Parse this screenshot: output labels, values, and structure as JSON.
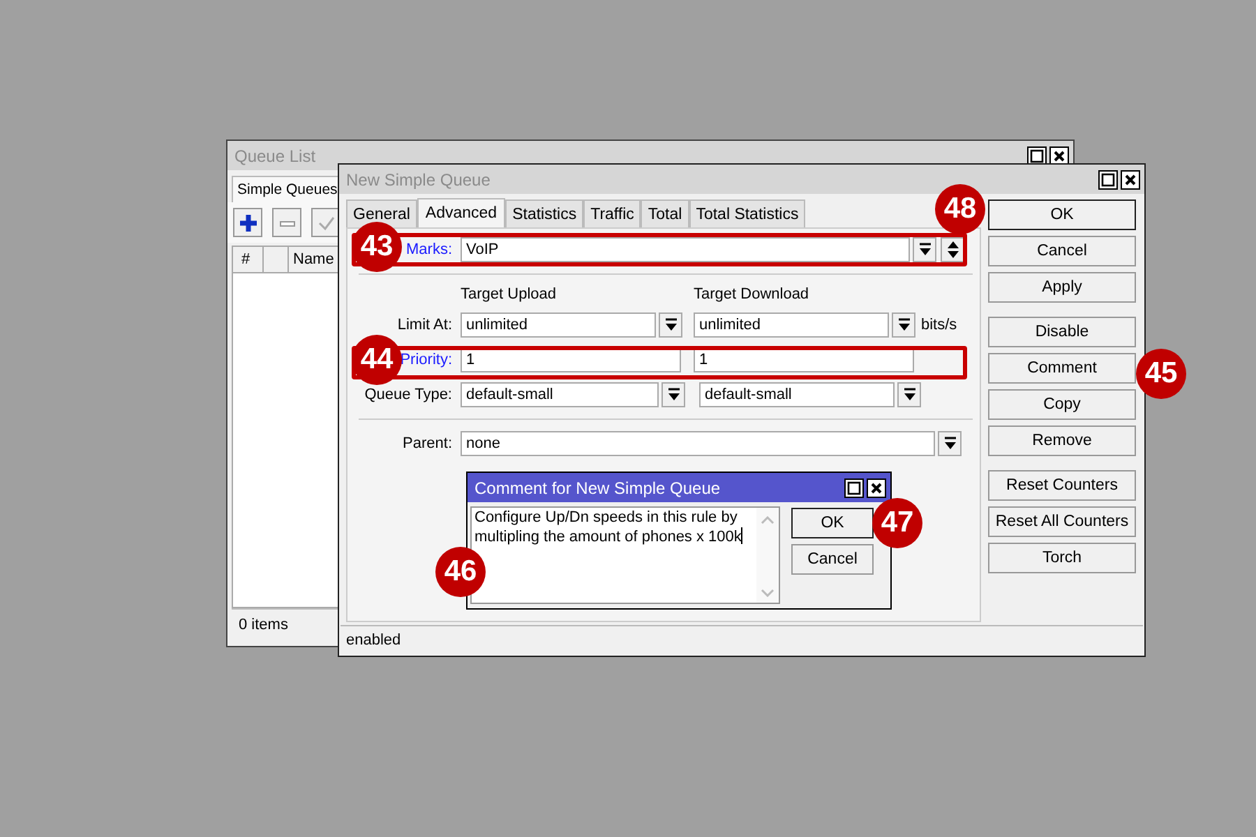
{
  "queue_list": {
    "title": "Queue List",
    "tabs": [
      {
        "label": "Simple Queues",
        "selected": true
      }
    ],
    "columns": [
      "#",
      "Name"
    ],
    "status": "0 items"
  },
  "dialog": {
    "title": "New Simple Queue",
    "tabs": [
      {
        "label": "General",
        "selected": false
      },
      {
        "label": "Advanced",
        "selected": true
      },
      {
        "label": "Statistics",
        "selected": false
      },
      {
        "label": "Traffic",
        "selected": false
      },
      {
        "label": "Total",
        "selected": false
      },
      {
        "label": "Total Statistics",
        "selected": false
      }
    ],
    "marks": {
      "label": "Marks:",
      "value": "VoIP"
    },
    "column_headers": [
      "Target Upload",
      "Target Download"
    ],
    "limit_at": {
      "label": "Limit At:",
      "upload": "unlimited",
      "download": "unlimited",
      "unit": "bits/s"
    },
    "priority": {
      "label": "Priority:",
      "upload": "1",
      "download": "1"
    },
    "queue_type": {
      "label": "Queue Type:",
      "upload": "default-small",
      "download": "default-small"
    },
    "parent": {
      "label": "Parent:",
      "value": "none"
    },
    "button_groups": [
      [
        {
          "label": "OK",
          "default": true
        },
        {
          "label": "Cancel",
          "default": false
        },
        {
          "label": "Apply",
          "default": false
        }
      ],
      [
        {
          "label": "Disable",
          "default": false
        },
        {
          "label": "Comment",
          "default": false
        },
        {
          "label": "Copy",
          "default": false
        },
        {
          "label": "Remove",
          "default": false
        }
      ],
      [
        {
          "label": "Reset Counters",
          "default": false
        },
        {
          "label": "Reset All Counters",
          "default": false
        },
        {
          "label": "Torch",
          "default": false
        }
      ]
    ],
    "status": "enabled"
  },
  "comment_dialog": {
    "title": "Comment for New Simple Queue",
    "text": "Configure Up/Dn speeds in this rule by multipling the amount of phones x 100k",
    "buttons": [
      {
        "label": "OK",
        "default": true
      },
      {
        "label": "Cancel",
        "default": false
      }
    ]
  },
  "callouts": [
    "43",
    "44",
    "45",
    "46",
    "47",
    "48"
  ]
}
